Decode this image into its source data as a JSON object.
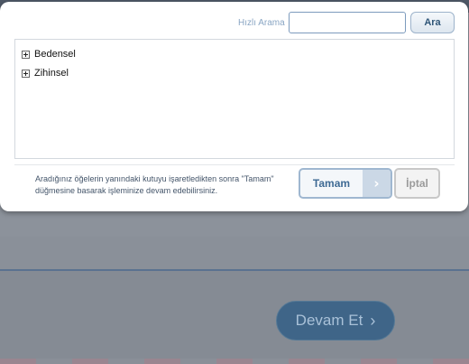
{
  "dialog": {
    "search_label": "Hızlı Arama",
    "search_value": "",
    "search_placeholder": "",
    "search_button": "Ara",
    "tree_items": [
      {
        "label": "Bedensel",
        "icon": "plus-icon"
      },
      {
        "label": "Zihinsel",
        "icon": "plus-icon"
      }
    ],
    "hint_line1": "Aradığınız öğelerin yanındaki kutuyu işaretledikten sonra \"Tamam\"",
    "hint_line2": "düğmesine basarak işleminize devam edebilirsiniz.",
    "ok_button": "Tamam",
    "ok_arrow_icon": "chevron-right-icon",
    "cancel_button": "İptal"
  },
  "background": {
    "continue_button": "Devam Et",
    "continue_icon": "chevron-right-icon"
  },
  "colors": {
    "accent": "#3e6a94",
    "overlay": "#8c929b",
    "continue_button_bg": "#3f6588"
  }
}
